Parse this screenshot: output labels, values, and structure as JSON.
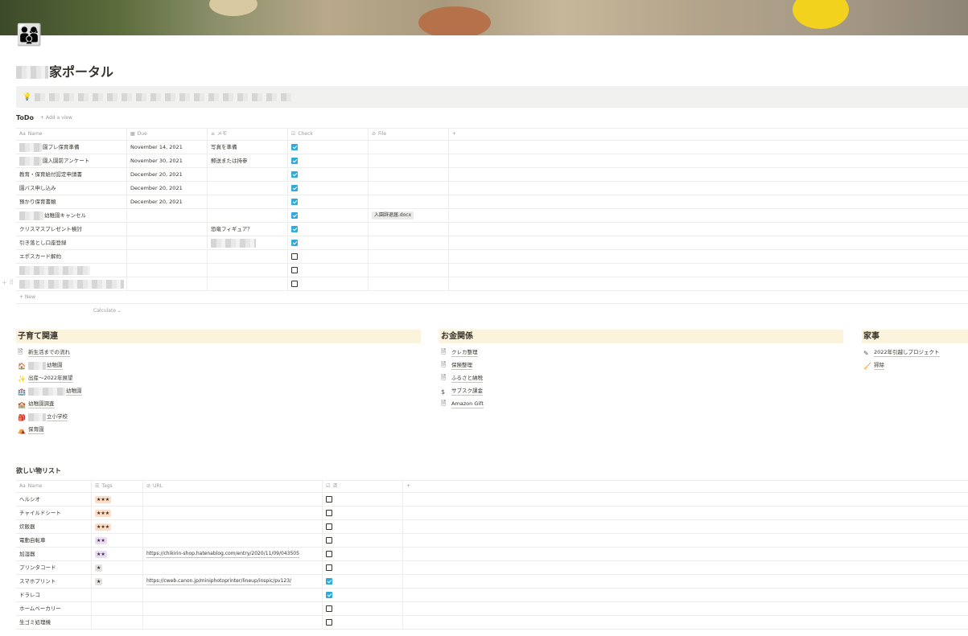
{
  "page": {
    "icon": "👨‍👩‍👦",
    "title_suffix": "家ポータル"
  },
  "todo": {
    "title": "ToDo",
    "add_view": "+ Add a view",
    "columns": [
      {
        "icon": "Aa",
        "label": "Name"
      },
      {
        "icon": "▦",
        "label": "Due"
      },
      {
        "icon": "≡",
        "label": "メモ"
      },
      {
        "icon": "☑",
        "label": "Check"
      },
      {
        "icon": "⊘",
        "label": "File"
      }
    ],
    "add_column": "+",
    "rows": [
      {
        "name": "園プレ保育準備",
        "due": "November 14, 2021",
        "memo": "写真を準備",
        "check": true,
        "file": ""
      },
      {
        "name": "園入園前アンケート",
        "due": "November 30, 2021",
        "memo": "郵送または持参",
        "check": true,
        "file": ""
      },
      {
        "name": "教育・保育給付認定申請書",
        "due": "December 20, 2021",
        "memo": "",
        "check": true,
        "file": ""
      },
      {
        "name": "園バス申し込み",
        "due": "December 20, 2021",
        "memo": "",
        "check": true,
        "file": ""
      },
      {
        "name": "預かり保育書類",
        "due": "December 20, 2021",
        "memo": "",
        "check": true,
        "file": ""
      },
      {
        "name": "幼稚園キャンセル",
        "due": "",
        "memo": "",
        "check": true,
        "file": "入園辞退届.docx"
      },
      {
        "name": "クリスマスプレゼント検討",
        "due": "",
        "memo": "恐竜フィギュア？",
        "check": true,
        "file": ""
      },
      {
        "name": "引き落とし口座登録",
        "due": "",
        "memo": "",
        "check": true,
        "file": ""
      },
      {
        "name": "エポスカード解約",
        "due": "",
        "memo": "",
        "check": false,
        "file": ""
      },
      {
        "name": "",
        "due": "",
        "memo": "",
        "check": false,
        "file": ""
      },
      {
        "name": "",
        "due": "",
        "memo": "",
        "check": false,
        "file": ""
      }
    ],
    "new_label": "+ New",
    "calculate_label": "Calculate ⌄"
  },
  "sections": [
    {
      "title": "子育て関連",
      "links": [
        {
          "icon": "page-icon",
          "glyph": "🗎",
          "label": "新生活までの流れ"
        },
        {
          "icon": "house-icon",
          "glyph": "🏠",
          "label": "幼稚園"
        },
        {
          "icon": "magic-wand-icon",
          "glyph": "✨",
          "label": "出産〜2022年展望"
        },
        {
          "icon": "hospital-icon",
          "glyph": "🏥",
          "label": "幼稚園"
        },
        {
          "icon": "school-icon",
          "glyph": "🏫",
          "label": "幼稚園調査"
        },
        {
          "icon": "backpack-icon",
          "glyph": "🎒",
          "label": "立小学校"
        },
        {
          "icon": "playground-icon",
          "glyph": "⛺",
          "label": "保育園"
        }
      ]
    },
    {
      "title": "お金関係",
      "links": [
        {
          "icon": "page-icon",
          "glyph": "🗎",
          "label": "クレカ整理"
        },
        {
          "icon": "page-icon",
          "glyph": "🗎",
          "label": "保険整理"
        },
        {
          "icon": "page-icon",
          "glyph": "🗎",
          "label": "ふるさと納税"
        },
        {
          "icon": "dollar-icon",
          "glyph": "$",
          "label": "サブスク課金"
        },
        {
          "icon": "page-icon",
          "glyph": "🗎",
          "label": "Amazon Gift"
        }
      ]
    },
    {
      "title": "家事",
      "links": [
        {
          "icon": "pencil-icon",
          "glyph": "✎",
          "label": "2022年引越しプロジェクト"
        },
        {
          "icon": "broom-icon",
          "glyph": "🧹",
          "label": "掃除"
        }
      ]
    }
  ],
  "wishlist": {
    "title": "欲しい物リスト",
    "columns": [
      {
        "icon": "Aa",
        "label": "Name"
      },
      {
        "icon": "☰",
        "label": "Tags"
      },
      {
        "icon": "⊘",
        "label": "URL"
      },
      {
        "icon": "☑",
        "label": "済"
      }
    ],
    "add_column": "+",
    "rows": [
      {
        "name": "ヘルシオ",
        "tag": "★★★",
        "url": "",
        "done": false
      },
      {
        "name": "チャイルドシート",
        "tag": "★★★",
        "url": "",
        "done": false
      },
      {
        "name": "炊飯器",
        "tag": "★★★",
        "url": "",
        "done": false
      },
      {
        "name": "電動自転車",
        "tag": "★★",
        "url": "",
        "done": false
      },
      {
        "name": "加湿器",
        "tag": "★★",
        "url": "https://chikirin-shop.hatenablog.com/entry/2020/11/09/043505",
        "done": false
      },
      {
        "name": "プリンタコード",
        "tag": "★",
        "url": "",
        "done": false
      },
      {
        "name": "スマホプリント",
        "tag": "★",
        "url": "https://cweb.canon.jp/miniphotoprinter/lineup/inspic/pv123/",
        "done": true
      },
      {
        "name": "ドラレコ",
        "tag": "",
        "url": "",
        "done": true
      },
      {
        "name": "ホームベーカリー",
        "tag": "",
        "url": "",
        "done": false
      },
      {
        "name": "生ゴミ処理機",
        "tag": "",
        "url": "",
        "done": false
      }
    ]
  }
}
